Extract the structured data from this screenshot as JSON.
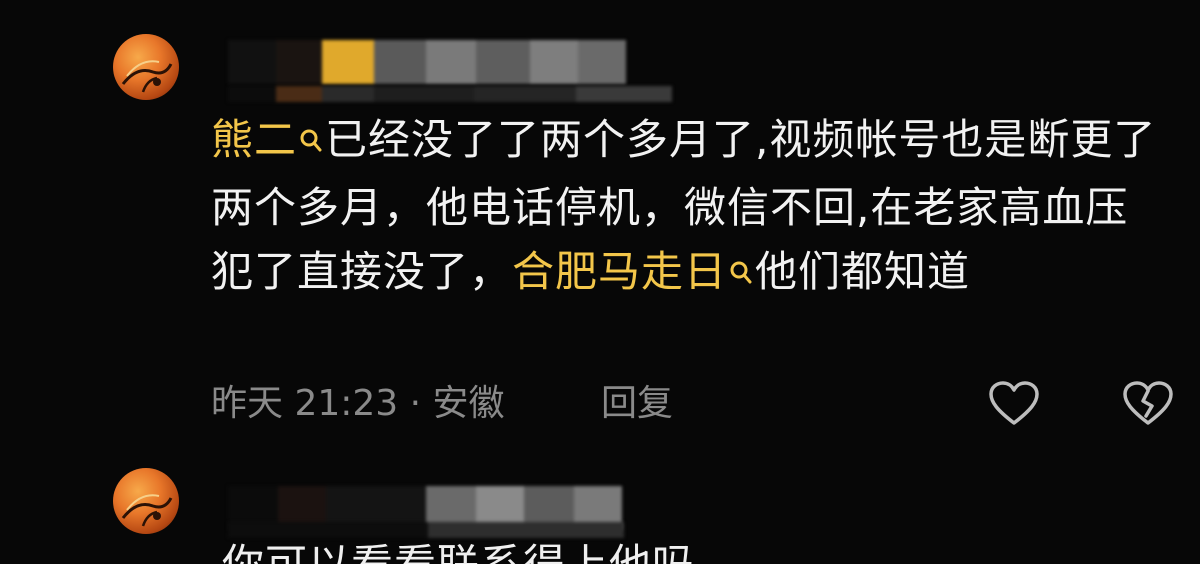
{
  "comments": [
    {
      "author_blurred": true,
      "segments": {
        "mention1": "熊二",
        "text1": "已经没了了两个多月了,视频帐号也是断更了两个多月，他电话停机，微信不回,在老家高血压犯了直接没了，",
        "mention2": "合肥马走日",
        "text2": "他们都知道"
      },
      "meta": "昨天 21:23 · 安徽",
      "reply_label": "回复",
      "like_icon": "heart-outline-icon",
      "dislike_icon": "broken-heart-icon"
    },
    {
      "author_blurred": true,
      "partial_text": "你可以看看联系得上他吗"
    }
  ],
  "colors": {
    "background": "#070707",
    "text": "#f2f2f2",
    "mention": "#f3c64a",
    "meta": "#8a8a8a"
  }
}
